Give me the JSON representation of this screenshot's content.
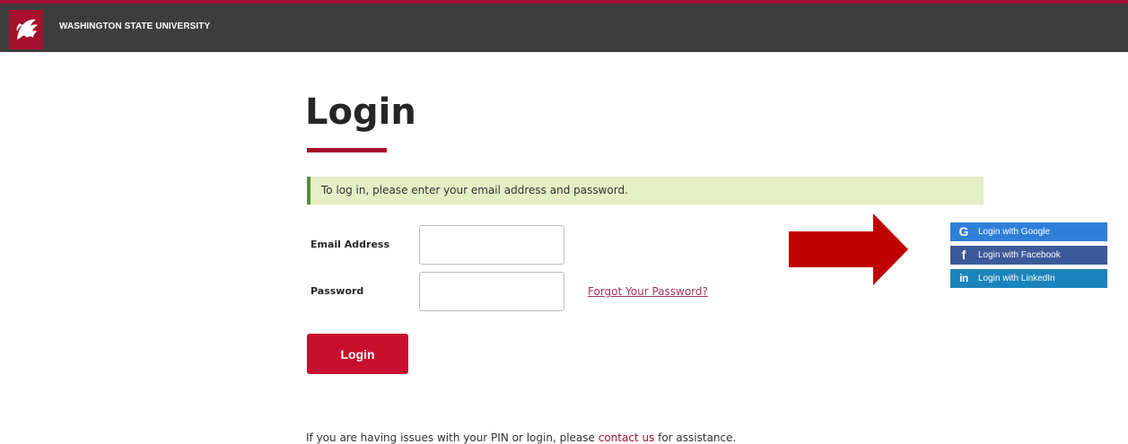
{
  "header": {
    "title": "WASHINGTON STATE UNIVERSITY",
    "logo_icon": "wsu-cougar-logo-icon",
    "brand_color": "#a60f2d"
  },
  "main": {
    "title": "Login",
    "notice": "To log in, please enter your email address and password.",
    "email_label": "Email Address",
    "email_value": "",
    "password_label": "Password",
    "password_value": "",
    "forgot_link": "Forgot Your Password?",
    "login_button": "Login",
    "help_prefix": "If you are having issues with your PIN or login, please ",
    "help_link": "contact us",
    "help_suffix": " for assistance."
  },
  "social": [
    {
      "label": "Login with Google",
      "icon": "google-icon",
      "color": "#2f7fd9"
    },
    {
      "label": "Login with Facebook",
      "icon": "facebook-icon",
      "color": "#3c5a99"
    },
    {
      "label": "Login with LinkedIn",
      "icon": "linkedin-icon",
      "color": "#1a84bc"
    }
  ],
  "annotation": {
    "arrow_icon": "red-arrow-right-icon",
    "arrow_color": "#c00000"
  }
}
